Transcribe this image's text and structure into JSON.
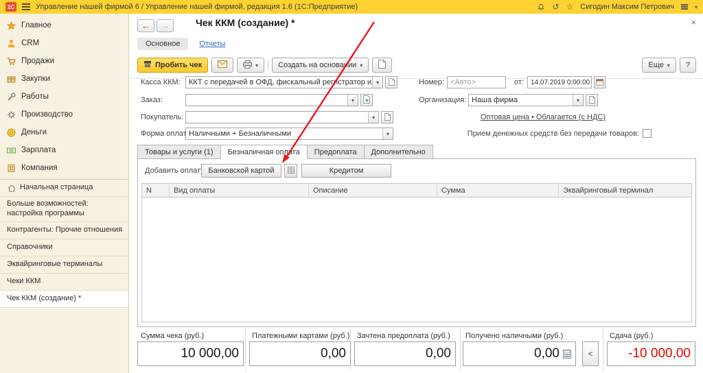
{
  "colors": {
    "titlebar": "#fdd231",
    "primary_button": "#fcc929",
    "link": "#2f6bc0",
    "negative": "#e60000",
    "sidebar_bg": "#f6f1e1"
  },
  "icons": {
    "back": "←",
    "forward": "→",
    "close": "×",
    "dropdown": "▾",
    "star": "☆",
    "history": "↺",
    "help": "?",
    "prev": "<"
  },
  "titlebar": {
    "logo": "1С",
    "title": "Управление нашей фирмой 6 / Управление нашей фирмой, редакция 1.6 (1С:Предприятие)",
    "user": "Сигодин Максим Петрович"
  },
  "sidebar": {
    "modules": [
      "Главное",
      "CRM",
      "Продажи",
      "Закупки",
      "Работы",
      "Производство",
      "Деньги",
      "Зарплата",
      "Компания"
    ],
    "nav": [
      "Начальная страница",
      "Больше возможностей: настройка программы",
      "Контрагенты: Прочие отношения",
      "Справочники",
      "Эквайринговые терминалы",
      "Чеки ККМ",
      "Чек ККМ (создание) *"
    ]
  },
  "page": {
    "title": "Чек ККМ (создание) *",
    "tabs": {
      "main": "Основное",
      "reports": "Отчеты"
    },
    "toolbar": {
      "post": "Пробить чек",
      "create_based": "Создать на основании",
      "more": "Еще",
      "help": "?"
    },
    "form": {
      "kassa_label": "Касса ККМ:",
      "kassa_value": "ККТ с передачей в ОФД, фискальный регистратор или АСП...",
      "number_label": "Номер:",
      "number_value": "<Авто>",
      "date_label": "от:",
      "date_value": "14.07.2019  0:00:00",
      "order_label": "Заказ:",
      "order_value": "",
      "org_label": "Организация:",
      "org_value": "Наша фирма",
      "customer_label": "Покупатель:",
      "customer_value": "",
      "price_link": "Оптовая цена • Облагается (с НДС)",
      "payment_form_label": "Форма оплаты:",
      "payment_form_value": "Наличными + Безналичными",
      "no_goods_label": "Прием денежных средств без передачи товаров:"
    },
    "detail_tabs": [
      "Товары и услуги (1)",
      "Безналичная оплата",
      "Предоплата",
      "Дополнительно"
    ],
    "payment_bar": {
      "label": "Добавить оплату:",
      "card": "Банковской картой",
      "credit": "Кредитом"
    },
    "table": {
      "columns": [
        "N",
        "Вид оплаты",
        "Описание",
        "Сумма",
        "Эквайринговый терминал"
      ],
      "rows": []
    },
    "totals": {
      "check_sum": {
        "label": "Сумма чека (руб.)",
        "value": "10 000,00"
      },
      "cards": {
        "label": "Платежными картами (руб.)",
        "value": "0,00"
      },
      "prepaid": {
        "label": "Зачтена предоплата (руб.)",
        "value": "0,00"
      },
      "cash": {
        "label": "Получено наличными (руб.)",
        "value": "0,00"
      },
      "change": {
        "label": "Сдача (руб.)",
        "value": "-10 000,00"
      }
    }
  }
}
